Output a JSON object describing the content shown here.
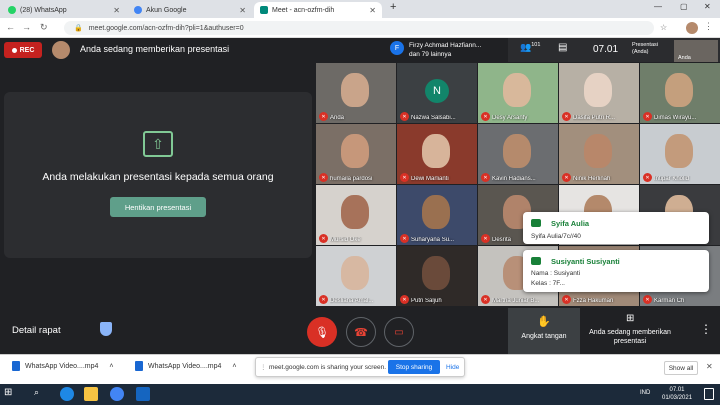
{
  "browser": {
    "tabs": [
      {
        "label": "(28) WhatsApp",
        "color": "#25d366"
      },
      {
        "label": "Akun Google",
        "color": "#4285f4"
      },
      {
        "label": "Meet - acn-ozfm-dih",
        "color": "#00897b"
      }
    ],
    "new_tab": "+",
    "url": "meet.google.com/acn-ozfm-dih?pli=1&authuser=0"
  },
  "meet": {
    "rec_label": "REC",
    "presenting_banner": "Anda sedang memberikan presentasi",
    "notification": {
      "initial": "F",
      "line1": "Firzy Achmad Hazfiann...",
      "line2": "dan 79 lainnya"
    },
    "participants_count": "101",
    "clock": "07.01",
    "self_label": "Presentasi (Anda)",
    "self_name": "Anda",
    "panel_text": "Anda melakukan presentasi kepada semua orang",
    "stop_button": "Hentikan presentasi",
    "tiles": [
      {
        "name": "Anda",
        "bg": "#6d6a66",
        "face": "#c9a48a"
      },
      {
        "name": "Nazwa Salsabi...",
        "letter": "N",
        "bg": "#3c4043"
      },
      {
        "name": "Desy Arsanty",
        "bg": "#8fb58a",
        "face": "#d8b89b"
      },
      {
        "name": "Dasifa Putri R...",
        "bg": "#b7b0a5",
        "face": "#e6d2c4"
      },
      {
        "name": "Dimas Wirayu...",
        "bg": "#6f7e6a",
        "face": "#c49f7d"
      },
      {
        "name": "humaila pardosi",
        "bg": "#7b6f66",
        "face": "#c6977a"
      },
      {
        "name": "Dewi Marlianti",
        "bg": "#8a3a2c",
        "face": "#d7b49a"
      },
      {
        "name": "Kavin Hadians...",
        "bg": "#6b6d70",
        "face": "#b58a6c"
      },
      {
        "name": "Ninik Herlinah",
        "bg": "#a28f7d",
        "face": "#b8876a"
      },
      {
        "name": "Intipar Kholid",
        "bg": "#c8ccd0",
        "face": "#c39b7c"
      },
      {
        "name": "Mursid Oke",
        "bg": "#d6d2cd",
        "face": "#a7725a"
      },
      {
        "name": "Suharyana Su...",
        "bg": "#3d4a6a",
        "face": "#9a7050"
      },
      {
        "name": "Desrita",
        "bg": "#5a5650",
        "face": "#b0836a"
      },
      {
        "name": "",
        "bg": "#e6e4e2",
        "face": "#b4896b"
      },
      {
        "name": "",
        "bg": "#3a3b3e",
        "face": "#cfae92"
      },
      {
        "name": "Desliana Amal...",
        "bg": "#cfd1d3",
        "face": "#d7b8a2"
      },
      {
        "name": "Putri Saljuh",
        "bg": "#2f2a28",
        "face": "#6a4a3a"
      },
      {
        "name": "Martha Juniar B...",
        "bg": "#c4c2be",
        "face": "#b89078"
      },
      {
        "name": "Fzza Hakuman",
        "bg": "#a08a78",
        "face": "#d0ae98"
      },
      {
        "name": "Karman Ch",
        "bg": "#7a7d80",
        "face": "#ba9276"
      }
    ],
    "chat": [
      {
        "name": "Syifa Aulia",
        "message": "Syifa Aulia/7c//40"
      },
      {
        "name": "Susiyanti Susiyanti",
        "line1": "Nama : Susiyanti",
        "line2": "Kelas : 7F..."
      }
    ],
    "meeting_details": "Detail rapat",
    "raise_hand": "Angkat tangan",
    "presenting_control": "Anda sedang memberikan presentasi"
  },
  "downloads": {
    "items": [
      "WhatsApp Video....mp4",
      "WhatsApp Video....mp4"
    ],
    "share_text": "meet.google.com is sharing your screen.",
    "stop_sharing": "Stop sharing",
    "hide": "Hide",
    "show_all": "Show all"
  },
  "taskbar": {
    "lang": "IND",
    "time": "07.01",
    "date": "01/03/2021"
  }
}
